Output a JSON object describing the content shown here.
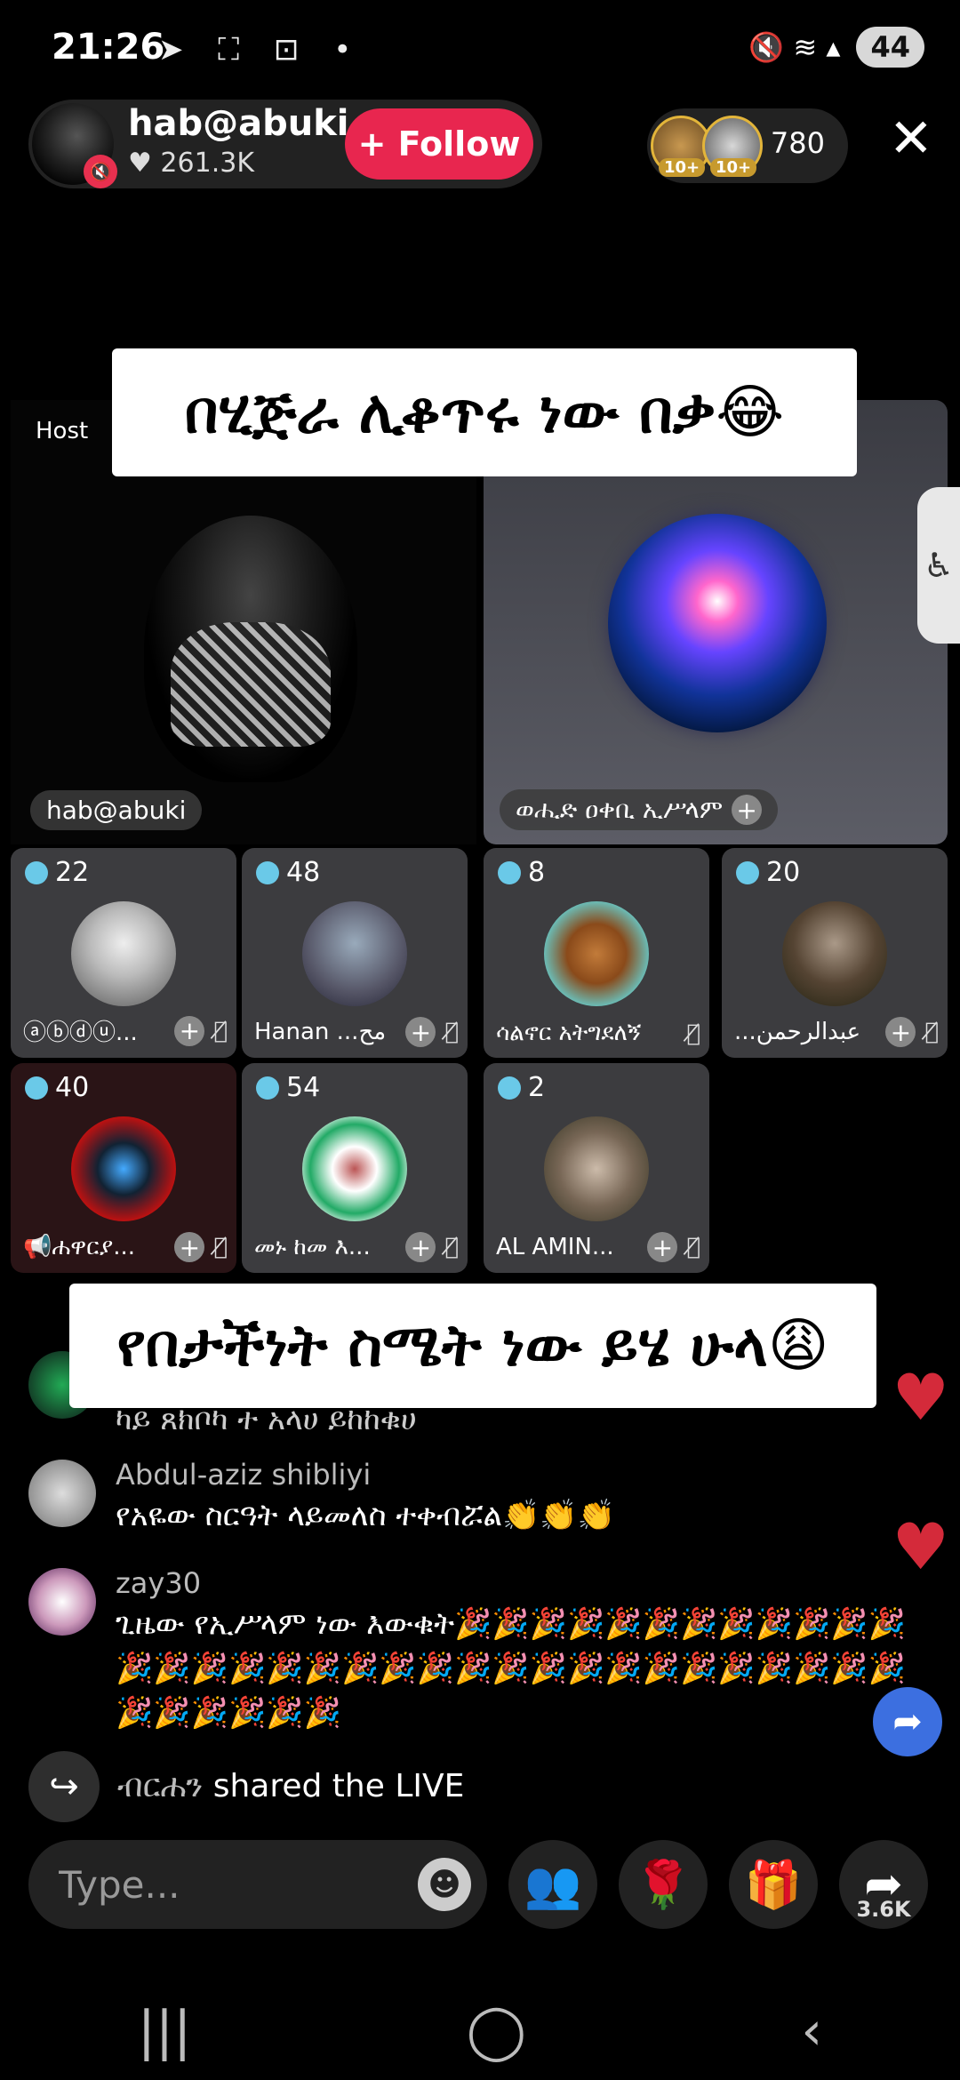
{
  "status_bar": {
    "time": "21:26",
    "left_icons": "➤ ⛶ ⊡ •",
    "right_icons": "🔇 ≋ ▴",
    "battery": "44"
  },
  "host": {
    "name": "hab@abuki",
    "likes": "♥ 261.3K",
    "follow_label": "+ Follow",
    "mute_icon": "🔇"
  },
  "viewers": {
    "badge1": "10+",
    "badge2": "10+",
    "count": "780"
  },
  "close_label": "✕",
  "captions": {
    "top": "በሂጅራ ሊቆጥሩ ነው በቃ😂",
    "middle": "የበታችነት ስሜት ነው ይሄ ሁላ😩"
  },
  "host_tile": {
    "label": "Host",
    "name": "hab@abuki"
  },
  "guest_tile": {
    "name": "ወሒድ ዐቀቢ ኢሥላም",
    "plus": "+"
  },
  "accessibility_icon": "♿",
  "seats": [
    {
      "count": "22",
      "name": "ⓐⓑⓓⓤ...",
      "plus": "+",
      "mic": "🎙̸"
    },
    {
      "count": "48",
      "name": "Hanan ...مح",
      "plus": "+",
      "mic": "🎙̸"
    },
    {
      "count": "8",
      "name": "ሳልኖር አትግደለኝ",
      "plus": "",
      "mic": "🎙̸"
    },
    {
      "count": "20",
      "name": "...عبدالرحمن",
      "plus": "+",
      "mic": "🎙̸"
    },
    {
      "count": "40",
      "name": "📢ሐዋርያ...",
      "plus": "+",
      "mic": "🎙̸"
    },
    {
      "count": "54",
      "name": "መኑ ከመ እ...",
      "plus": "+",
      "mic": "🎙̸"
    },
    {
      "count": "2",
      "name": "AL AMIN...",
      "plus": "+",
      "mic": "🎙̸"
    }
  ],
  "comments": [
    {
      "user": "",
      "text": "ካይ ጸክቦካ ተ አላሀ ይከከቁሀ"
    },
    {
      "user": "Abdul-aziz shibliyi",
      "text": "የአዬው ስርዓት ላይመለስ ተቀብሯል👏👏👏"
    },
    {
      "user": "zay30",
      "text": "ጊዜው የኢሥላም ነው እውቁት🎉🎉🎉🎉🎉🎉🎉🎉🎉🎉🎉🎉🎉🎉🎉🎉🎉🎉🎉🎉🎉🎉🎉🎉🎉🎉🎉🎉🎉🎉🎉🎉🎉🎉🎉🎉🎉🎉🎉"
    }
  ],
  "hearts": [
    "♥",
    "♥"
  ],
  "share_event": {
    "who": "ብርሐን",
    "action": " shared the LIVE",
    "icon": "↪"
  },
  "fab_share_icon": "➦",
  "input": {
    "placeholder": "Type...",
    "emoji_icon": "☻"
  },
  "bottom_buttons": {
    "guests_icon": "👥",
    "rose_icon": "🌹",
    "gift_icon": "🎁",
    "share_icon": "➦",
    "share_count": "3.6K"
  },
  "nav": {
    "recent": "|||",
    "home": "◯",
    "back": "‹"
  },
  "colors": {
    "follow": "#e8264f",
    "heart": "#d42a3a",
    "fab": "#3c6fe0"
  }
}
